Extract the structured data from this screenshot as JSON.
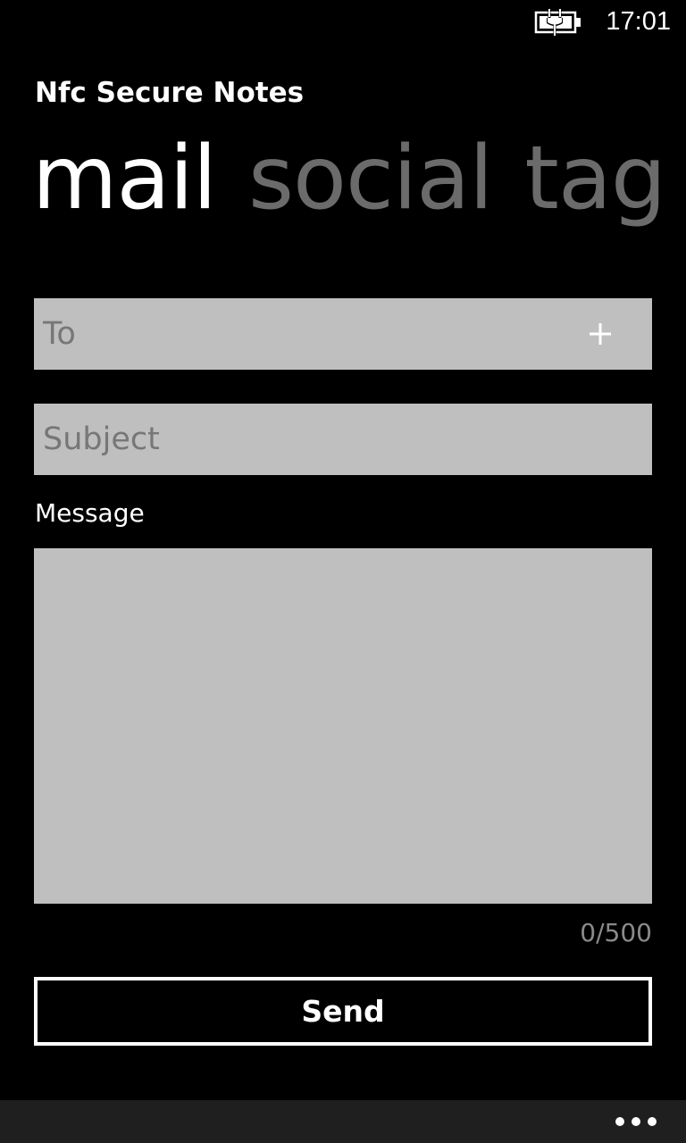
{
  "status_bar": {
    "time": "17:01",
    "battery_icon": "battery-charging-icon"
  },
  "app": {
    "title": "Nfc Secure Notes"
  },
  "pivot": {
    "items": [
      {
        "label": "mail",
        "active": true
      },
      {
        "label": "social",
        "active": false
      },
      {
        "label": "tag",
        "active": false
      }
    ]
  },
  "form": {
    "to_placeholder": "To",
    "to_value": "",
    "add_icon": "plus-icon",
    "subject_placeholder": "Subject",
    "subject_value": "",
    "message_label": "Message",
    "message_value": "",
    "char_count": "0/500",
    "send_label": "Send"
  },
  "app_bar": {
    "more_icon": "ellipsis-icon"
  },
  "colors": {
    "background": "#000000",
    "input_background": "#bfbfbf",
    "inactive_pivot": "#6b6b6b",
    "app_bar": "#1f1f1f"
  }
}
